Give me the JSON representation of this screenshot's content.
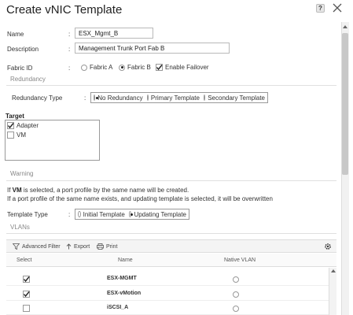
{
  "dialog": {
    "title": "Create vNIC Template",
    "help_glyph": "?"
  },
  "form": {
    "name_label": "Name",
    "name_value": "ESX_Mgmt_B",
    "description_label": "Description",
    "description_value": "Management Trunk Port Fab B",
    "fabric_label": "Fabric ID",
    "fabric_options": [
      "Fabric A",
      "Fabric B"
    ],
    "fabric_selected": "Fabric B",
    "enable_failover_label": "Enable Failover",
    "enable_failover_checked": true,
    "colon": ":"
  },
  "redundancy": {
    "section_title": "Redundancy",
    "type_label": "Redundancy Type",
    "options": [
      "No Redundancy",
      "Primary Template",
      "Secondary Template"
    ],
    "selected": "No Redundancy"
  },
  "target": {
    "title": "Target",
    "items": [
      {
        "label": "Adapter",
        "checked": true
      },
      {
        "label": "VM",
        "checked": false
      }
    ]
  },
  "warning": {
    "section_title": "Warning",
    "line1_prefix": "If ",
    "line1_bold": "VM",
    "line1_suffix": " is selected, a port profile by the same name will be created.",
    "line2": "If a port profile of the same name exists, and updating template is selected, it will be overwritten"
  },
  "template_type": {
    "label": "Template Type",
    "options": [
      "Initial Template",
      "Updating Template"
    ],
    "selected": "Updating Template"
  },
  "vlans": {
    "section_title": "VLANs",
    "toolbar": {
      "filter_label": "Advanced Filter",
      "export_label": "Export",
      "print_label": "Print"
    },
    "columns": [
      "Select",
      "Name",
      "Native VLAN"
    ],
    "rows": [
      {
        "name": "ESX-MGMT",
        "selected": true,
        "native": false
      },
      {
        "name": "ESX-vMotion",
        "selected": true,
        "native": false
      },
      {
        "name": "iSCSI_A",
        "selected": false,
        "native": false
      }
    ]
  },
  "colors": {
    "accent_scroll": "#c8c8c8",
    "text": "#333333"
  }
}
